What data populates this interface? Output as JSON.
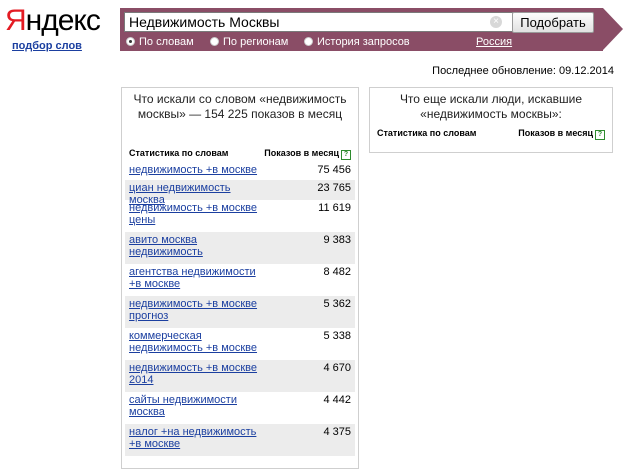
{
  "header": {
    "logo_first": "Я",
    "logo_rest": "ндекс",
    "sub_link": "подбор слов"
  },
  "search": {
    "value": "Недвижимость Москвы",
    "submit_label": "Подобрать",
    "clear_symbol": "×",
    "options": [
      {
        "label": "По словам",
        "checked": true
      },
      {
        "label": "По регионам",
        "checked": false
      },
      {
        "label": "История запросов",
        "checked": false
      }
    ],
    "region_link": "Россия"
  },
  "last_update": "Последнее обновление: 09.12.2014",
  "left_panel": {
    "title": "Что искали со словом «недвижимость москвы» — 154 225 показов в месяц",
    "col_keywords": "Статистика по словам",
    "col_shows": "Показов в месяц",
    "help_icon": "?",
    "rows": [
      {
        "keyword": "недвижимость +в москве",
        "count": "75 456"
      },
      {
        "keyword": "циан недвижимость москва",
        "count": "23 765"
      },
      {
        "keyword": "недвижимость +в москве цены",
        "count": "11 619"
      },
      {
        "keyword": "авито москва недвижимость",
        "count": "9 383"
      },
      {
        "keyword": "агентства недвижимости +в москве",
        "count": "8 482"
      },
      {
        "keyword": "недвижимость +в москве прогноз",
        "count": "5 362"
      },
      {
        "keyword": "коммерческая недвижимость +в москве",
        "count": "5 338"
      },
      {
        "keyword": "недвижимость +в москве 2014",
        "count": "4 670"
      },
      {
        "keyword": "сайты недвижимости москва",
        "count": "4 442"
      },
      {
        "keyword": "налог +на недвижимость +в москве",
        "count": "4 375"
      }
    ]
  },
  "right_panel": {
    "title": "Что еще искали люди, искавшие «недвижимость москвы»:",
    "col_keywords": "Статистика по словам",
    "col_shows": "Показов в месяц",
    "help_icon": "?"
  }
}
